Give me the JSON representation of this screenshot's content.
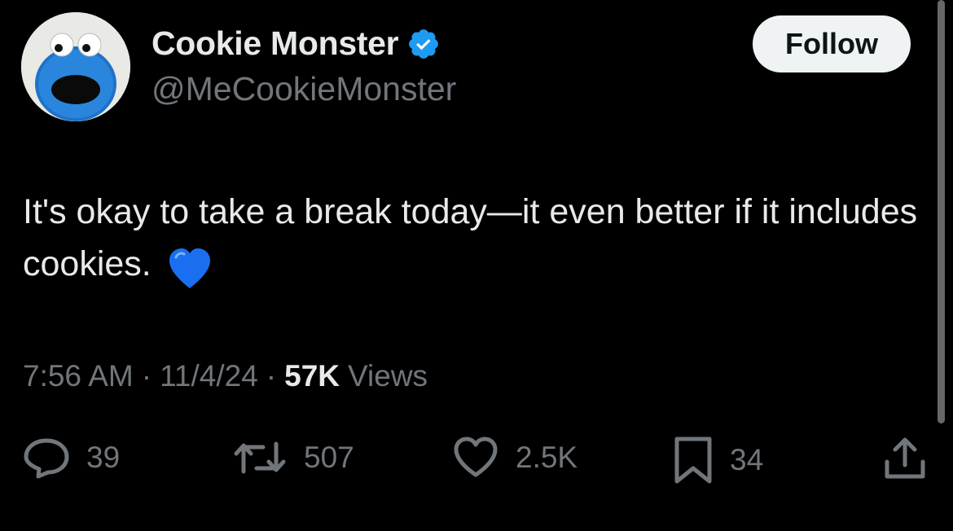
{
  "author": {
    "display_name": "Cookie Monster",
    "handle": "@MeCookieMonster",
    "verified": true,
    "verified_color": "#1d9bf0",
    "avatar_icon": "cookie-monster-avatar"
  },
  "follow_button": {
    "label": "Follow"
  },
  "tweet": {
    "text": "It's okay to take a break today—it even better if it includes cookies.",
    "emoji": "blue-heart-emoji"
  },
  "meta": {
    "time": "7:56 AM",
    "separator": "·",
    "date": "11/4/24",
    "views_count": "57K",
    "views_label": "Views"
  },
  "actions": {
    "replies": {
      "icon": "reply-icon",
      "count": "39"
    },
    "reposts": {
      "icon": "repost-icon",
      "count": "507"
    },
    "likes": {
      "icon": "like-icon",
      "count": "2.5K"
    },
    "bookmarks": {
      "icon": "bookmark-icon",
      "count": "34"
    },
    "share": {
      "icon": "share-icon"
    }
  },
  "colors": {
    "background": "#000000",
    "text_primary": "#e7e9ea",
    "text_secondary": "#71767b",
    "emoji_blue": "#1a6ff0"
  }
}
